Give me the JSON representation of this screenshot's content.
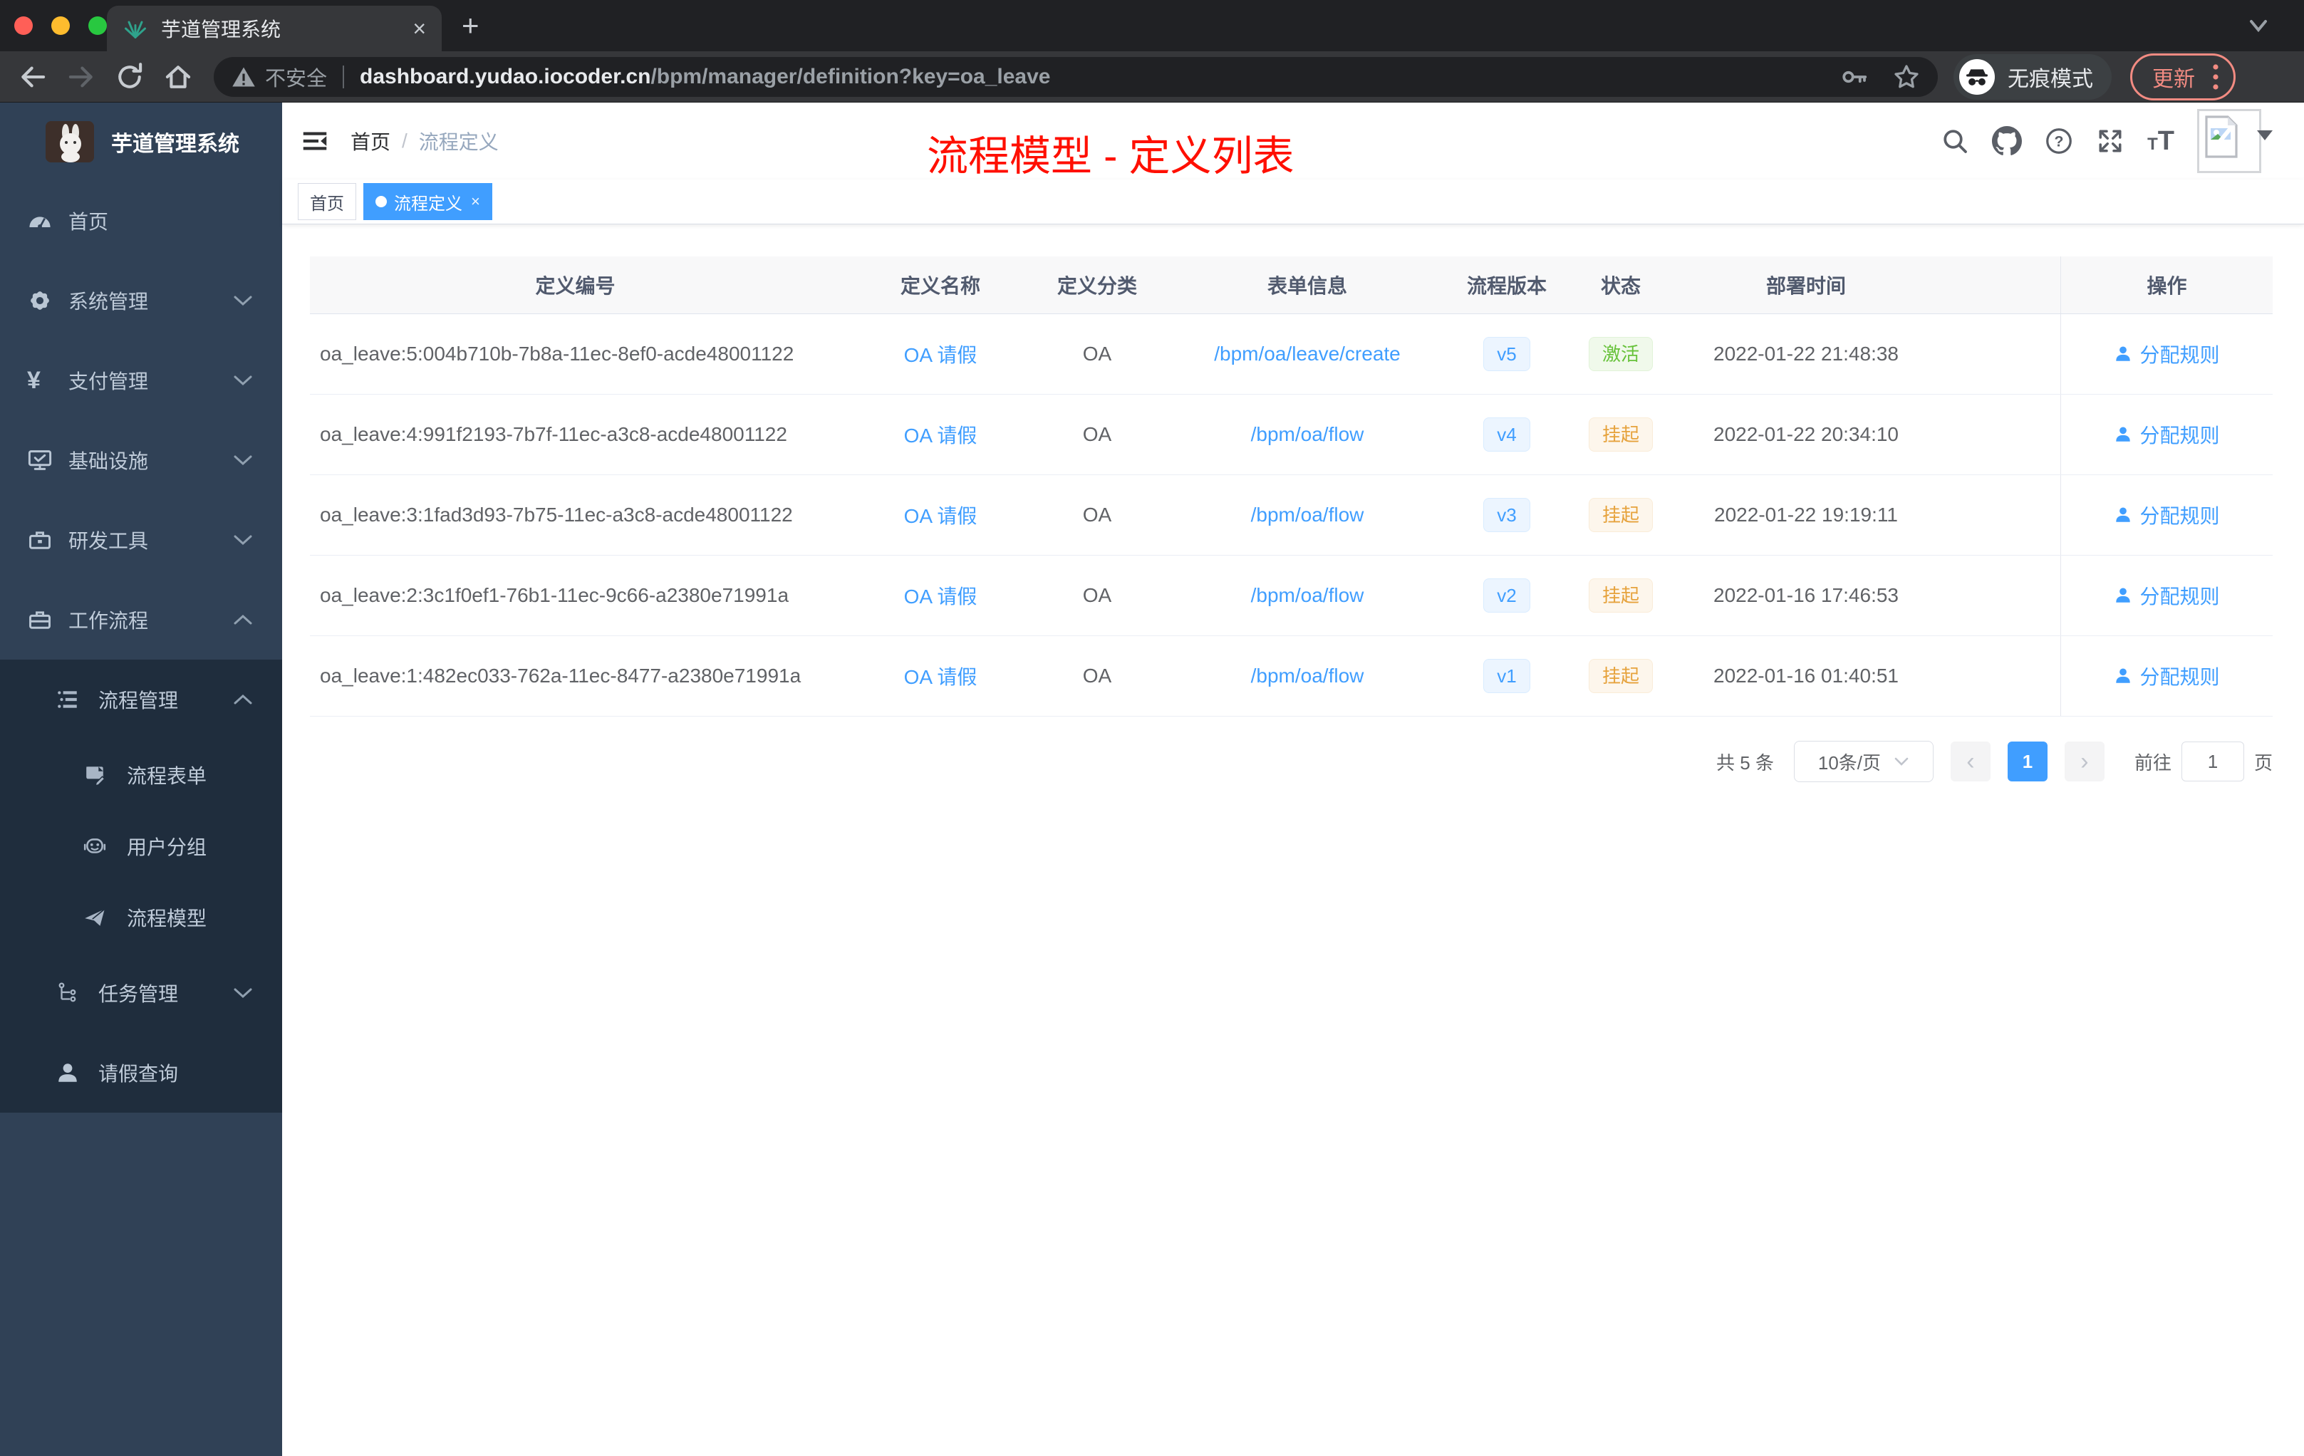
{
  "colors": {
    "accent": "#409eff",
    "success": "#67c23a",
    "warning": "#e6a23c",
    "annotation": "#ff0f00",
    "sidebar": "#304156",
    "sidebar_sub": "#1f2d3d",
    "update_button": "#f28b82"
  },
  "browser": {
    "tab_title": "芋道管理系统",
    "tab_close": "×",
    "new_tab": "+",
    "security_label": "不安全",
    "url_host": "dashboard.yudao.iocoder.cn",
    "url_path": "/bpm/manager/definition?key=oa_leave",
    "incognito_label": "无痕模式",
    "update_label": "更新"
  },
  "sidebar": {
    "logo_title": "芋道管理系统",
    "items": [
      {
        "label": "首页"
      },
      {
        "label": "系统管理"
      },
      {
        "label": "支付管理"
      },
      {
        "label": "基础设施"
      },
      {
        "label": "研发工具"
      },
      {
        "label": "工作流程"
      },
      {
        "label": "流程管理"
      },
      {
        "label": "流程表单"
      },
      {
        "label": "用户分组"
      },
      {
        "label": "流程模型"
      },
      {
        "label": "任务管理"
      },
      {
        "label": "请假查询"
      }
    ]
  },
  "header": {
    "breadcrumb_home": "首页",
    "breadcrumb_sep": "/",
    "breadcrumb_current": "流程定义",
    "annotation": "流程模型 - 定义列表"
  },
  "tags": {
    "home": "首页",
    "active": "流程定义",
    "close": "×"
  },
  "table": {
    "columns": {
      "id": "定义编号",
      "name": "定义名称",
      "category": "定义分类",
      "form": "表单信息",
      "version": "流程版本",
      "status": "状态",
      "deploy_time": "部署时间",
      "action": "操作"
    },
    "rows": [
      {
        "id": "oa_leave:5:004b710b-7b8a-11ec-8ef0-acde48001122",
        "name": "OA 请假",
        "category": "OA",
        "form": "/bpm/oa/leave/create",
        "version": "v5",
        "status": "激活",
        "status_type": "success",
        "time": "2022-01-22 21:48:38",
        "action": "分配规则"
      },
      {
        "id": "oa_leave:4:991f2193-7b7f-11ec-a3c8-acde48001122",
        "name": "OA 请假",
        "category": "OA",
        "form": "/bpm/oa/flow",
        "version": "v4",
        "status": "挂起",
        "status_type": "warning",
        "time": "2022-01-22 20:34:10",
        "action": "分配规则"
      },
      {
        "id": "oa_leave:3:1fad3d93-7b75-11ec-a3c8-acde48001122",
        "name": "OA 请假",
        "category": "OA",
        "form": "/bpm/oa/flow",
        "version": "v3",
        "status": "挂起",
        "status_type": "warning",
        "time": "2022-01-22 19:19:11",
        "action": "分配规则"
      },
      {
        "id": "oa_leave:2:3c1f0ef1-76b1-11ec-9c66-a2380e71991a",
        "name": "OA 请假",
        "category": "OA",
        "form": "/bpm/oa/flow",
        "version": "v2",
        "status": "挂起",
        "status_type": "warning",
        "time": "2022-01-16 17:46:53",
        "action": "分配规则"
      },
      {
        "id": "oa_leave:1:482ec033-762a-11ec-8477-a2380e71991a",
        "name": "OA 请假",
        "category": "OA",
        "form": "/bpm/oa/flow",
        "version": "v1",
        "status": "挂起",
        "status_type": "warning",
        "time": "2022-01-16 01:40:51",
        "action": "分配规则"
      }
    ]
  },
  "pagination": {
    "total": "共 5 条",
    "page_size": "10条/页",
    "prev": "‹",
    "current": "1",
    "next": "›",
    "goto_label": "前往",
    "goto_value": "1",
    "page_label": "页"
  }
}
